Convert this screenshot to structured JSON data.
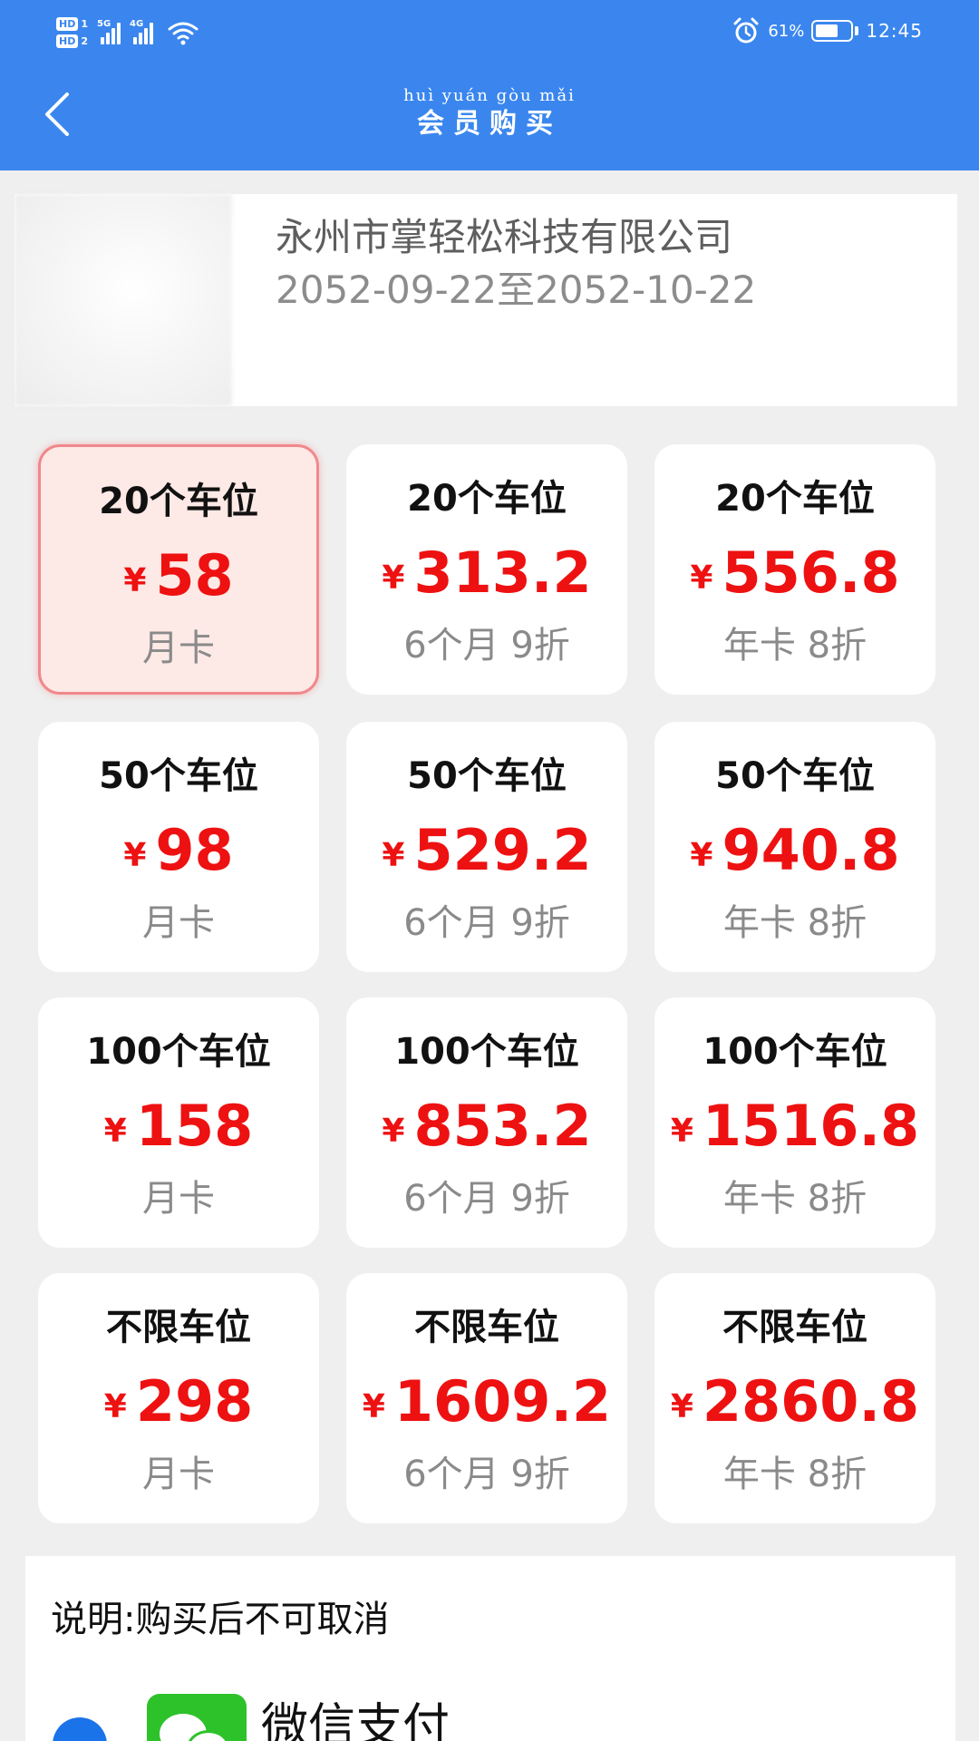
{
  "status_bar": {
    "sim1_badge": "HD",
    "sim1_num": "1",
    "sim2_badge": "HD",
    "sim2_num": "2",
    "network1": "5G",
    "network2": "4G",
    "battery_percent": "61%",
    "time": "12:45",
    "icons": [
      "signal-icon",
      "wifi-icon",
      "alarm-icon",
      "battery-icon"
    ]
  },
  "header": {
    "pinyin": "huì yuán gòu mǎi",
    "title": "会员购买",
    "back_icon": "chevron-left-icon"
  },
  "company": {
    "name": "永州市掌轻松科技有限公司",
    "period": "2052-09-22至2052-10-22"
  },
  "plans": [
    {
      "spaces": "20个车位",
      "currency": "¥",
      "price": "58",
      "desc": "月卡",
      "selected": true
    },
    {
      "spaces": "20个车位",
      "currency": "¥",
      "price": "313.2",
      "desc": "6个月 9折",
      "selected": false
    },
    {
      "spaces": "20个车位",
      "currency": "¥",
      "price": "556.8",
      "desc": "年卡 8折",
      "selected": false
    },
    {
      "spaces": "50个车位",
      "currency": "¥",
      "price": "98",
      "desc": "月卡",
      "selected": false
    },
    {
      "spaces": "50个车位",
      "currency": "¥",
      "price": "529.2",
      "desc": "6个月 9折",
      "selected": false
    },
    {
      "spaces": "50个车位",
      "currency": "¥",
      "price": "940.8",
      "desc": "年卡 8折",
      "selected": false
    },
    {
      "spaces": "100个车位",
      "currency": "¥",
      "price": "158",
      "desc": "月卡",
      "selected": false
    },
    {
      "spaces": "100个车位",
      "currency": "¥",
      "price": "853.2",
      "desc": "6个月 9折",
      "selected": false
    },
    {
      "spaces": "100个车位",
      "currency": "¥",
      "price": "1516.8",
      "desc": "年卡 8折",
      "selected": false
    },
    {
      "spaces": "不限车位",
      "currency": "¥",
      "price": "298",
      "desc": "月卡",
      "selected": false
    },
    {
      "spaces": "不限车位",
      "currency": "¥",
      "price": "1609.2",
      "desc": "6个月 9折",
      "selected": false
    },
    {
      "spaces": "不限车位",
      "currency": "¥",
      "price": "2860.8",
      "desc": "年卡 8折",
      "selected": false
    }
  ],
  "notice": {
    "text": "说明:购买后不可取消"
  },
  "payment": {
    "label": "微信支付",
    "icon": "wechat-pay-icon"
  },
  "colors": {
    "header": "#3a86ee",
    "price": "#ee1111",
    "selected_bg": "#fde9e6",
    "selected_border": "#f0888c",
    "wechat": "#2ec22a"
  }
}
